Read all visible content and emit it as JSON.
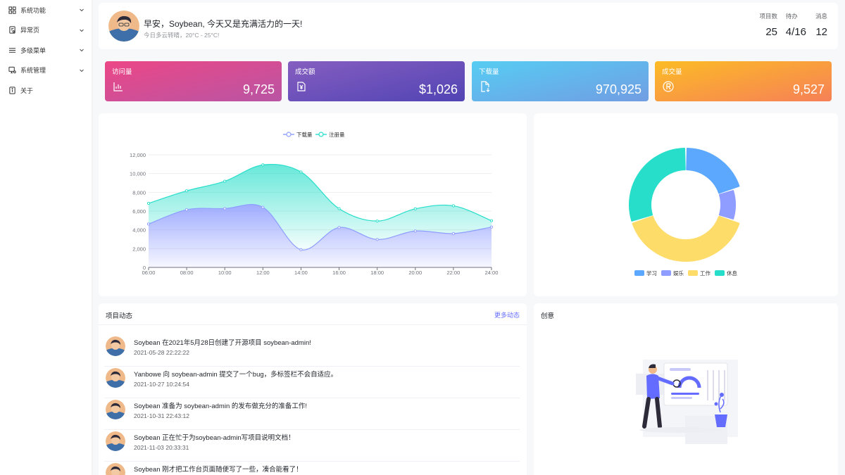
{
  "sidebar": {
    "items": [
      {
        "label": "系统功能",
        "icon": "grid-icon",
        "has_children": true
      },
      {
        "label": "异常页",
        "icon": "error-page-icon",
        "has_children": true
      },
      {
        "label": "多级菜单",
        "icon": "menu-lines-icon",
        "has_children": true
      },
      {
        "label": "系统管理",
        "icon": "monitor-settings-icon",
        "has_children": true
      },
      {
        "label": "关于",
        "icon": "about-icon",
        "has_children": false
      }
    ]
  },
  "header": {
    "greeting": "早安，Soybean, 今天又是充满活力的一天!",
    "weather": "今日多云转晴，20°C - 25°C!",
    "stats": [
      {
        "label": "项目数",
        "value": "25"
      },
      {
        "label": "待办",
        "value": "4/16"
      },
      {
        "label": "消息",
        "value": "12"
      }
    ]
  },
  "metrics": [
    {
      "title": "访问量",
      "value": "9,725",
      "icon": "bar-chart-icon",
      "from": "#ec4786",
      "to": "#b955a4"
    },
    {
      "title": "成交额",
      "value": "$1,026",
      "icon": "money-icon",
      "from": "#865ec0",
      "to": "#5144b4"
    },
    {
      "title": "下载量",
      "value": "970,925",
      "icon": "download-file-icon",
      "from": "#56cdf3",
      "to": "#719de3"
    },
    {
      "title": "成交量",
      "value": "9,527",
      "icon": "registered-icon",
      "from": "#fcbc25",
      "to": "#f68057"
    }
  ],
  "line_chart": {
    "chart_data": {
      "type": "area",
      "x": [
        "06:00",
        "08:00",
        "10:00",
        "12:00",
        "14:00",
        "16:00",
        "18:00",
        "20:00",
        "22:00",
        "24:00"
      ],
      "ylim": [
        0,
        12000
      ],
      "yticks": [
        0,
        2000,
        4000,
        6000,
        8000,
        10000,
        12000
      ],
      "ytick_labels": [
        "0",
        "2,000",
        "4,000",
        "6,000",
        "8,000",
        "10,000",
        "12,000"
      ],
      "grid": true,
      "legend": "top-center",
      "series": [
        {
          "name": "下载量",
          "color": "#8e9dff",
          "values": [
            4623,
            6145,
            6268,
            6411,
            1890,
            4251,
            2978,
            3880,
            3610,
            4300
          ]
        },
        {
          "name": "注册量",
          "color": "#26deca",
          "values": [
            2208,
            2016,
            2916,
            4512,
            8281,
            2008,
            1963,
            2367,
            2956,
            678
          ]
        }
      ]
    }
  },
  "pie_chart": {
    "chart_data": {
      "type": "pie",
      "legend": "bottom-center",
      "slices": [
        {
          "name": "学习",
          "value": 20,
          "color": "#5da8ff"
        },
        {
          "name": "娱乐",
          "value": 10,
          "color": "#8e9dff"
        },
        {
          "name": "工作",
          "value": 40,
          "color": "#fedc69"
        },
        {
          "name": "休息",
          "value": 30,
          "color": "#26deca"
        }
      ]
    }
  },
  "activity": {
    "title": "项目动态",
    "more": "更多动态",
    "items": [
      {
        "text": "Soybean 在2021年5月28日创建了开源项目 soybean-admin!",
        "time": "2021-05-28 22:22:22"
      },
      {
        "text": "Yanbowe 向 soybean-admin 提交了一个bug，多标签栏不会自适应。",
        "time": "2021-10-27 10:24:54"
      },
      {
        "text": "Soybean 准备为 soybean-admin 的发布做充分的准备工作!",
        "time": "2021-10-31 22:43:12"
      },
      {
        "text": "Soybean 正在忙于为soybean-admin写项目说明文档！",
        "time": "2021-11-03 20:33:31"
      },
      {
        "text": "Soybean 刚才把工作台页面随便写了一些，凑合能看了！",
        "time": ""
      }
    ]
  },
  "creative": {
    "title": "创意"
  }
}
